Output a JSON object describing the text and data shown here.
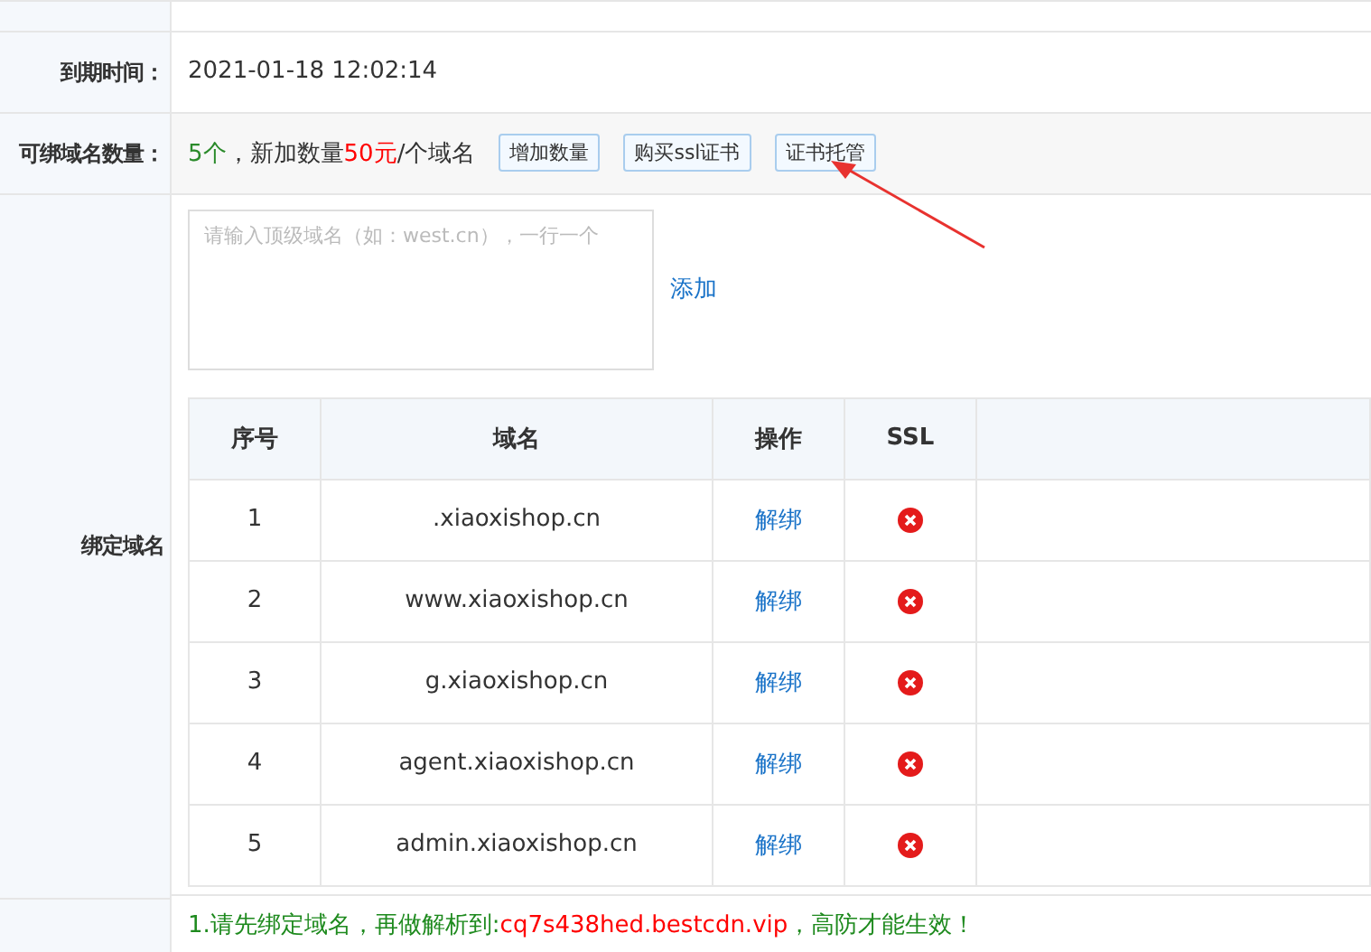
{
  "expire": {
    "label": "到期时间：",
    "value": "2021-01-18 12:02:14"
  },
  "quota": {
    "label": "可绑域名数量：",
    "parts": [
      {
        "kind": "count",
        "text": "5个"
      },
      {
        "kind": "plain",
        "text": "，新加数量"
      },
      {
        "kind": "price",
        "text": "50元"
      },
      {
        "kind": "plain",
        "text": "/个域名"
      }
    ],
    "buttons": [
      "增加数量",
      "购买ssl证书",
      "证书托管"
    ]
  },
  "bind": {
    "label": "绑定域名",
    "input": {
      "placeholder": "请输入顶级域名（如：west.cn），一行一个"
    },
    "add_link": "添加",
    "table": {
      "columns": [
        "序号",
        "域名",
        "操作",
        "SSL"
      ],
      "rows": [
        {
          "index": "1",
          "domain": ".xiaoxishop.cn",
          "action": "解绑",
          "ssl": false
        },
        {
          "index": "2",
          "domain": "www.xiaoxishop.cn",
          "action": "解绑",
          "ssl": false
        },
        {
          "index": "3",
          "domain": "g.xiaoxishop.cn",
          "action": "解绑",
          "ssl": false
        },
        {
          "index": "4",
          "domain": "agent.xiaoxishop.cn",
          "action": "解绑",
          "ssl": false
        },
        {
          "index": "5",
          "domain": "admin.xiaoxishop.cn",
          "action": "解绑",
          "ssl": false
        }
      ]
    }
  },
  "note": {
    "parts": [
      {
        "kind": "plain",
        "text": "1.请先绑定域名，再做解析到:"
      },
      {
        "kind": "highlight",
        "text": "cq7s438hed.bestcdn.vip"
      },
      {
        "kind": "plain",
        "text": "，高防才能生效！"
      }
    ]
  }
}
